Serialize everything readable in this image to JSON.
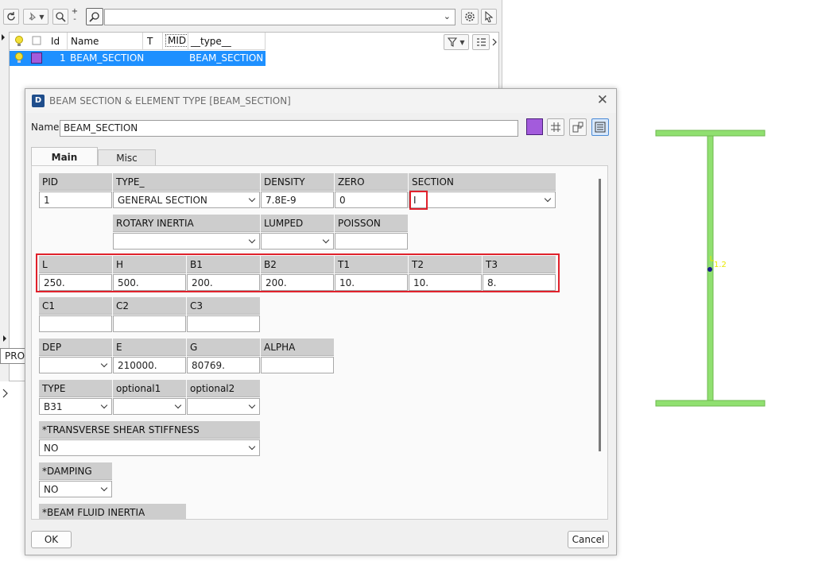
{
  "toolbar": {
    "zoom_plus": "+",
    "zoom_minus": "-",
    "filter_value": ""
  },
  "grid": {
    "columns": [
      "Id",
      "Name",
      "T",
      "MID",
      "__type__"
    ],
    "rows": [
      {
        "id": "1",
        "name": "BEAM_SECTION",
        "t": "",
        "mid": "",
        "type": "BEAM_SECTION",
        "color": "#a35bdc"
      }
    ]
  },
  "side_tab": {
    "label": "PRO"
  },
  "viewport": {
    "node_label": "1.2",
    "beam_color": "#90e070",
    "node_color": "#1a1a8c",
    "label_color": "#e8e800"
  },
  "dialog": {
    "title": "BEAM SECTION & ELEMENT TYPE [BEAM_SECTION]",
    "name_label": "Name",
    "name_value": "BEAM_SECTION",
    "color": "#a35bdc",
    "tabs": [
      "Main",
      "Misc"
    ],
    "ok_label": "OK",
    "cancel_label": "Cancel",
    "highlight_color": "#e0212b",
    "fields": {
      "pid": {
        "label": "PID",
        "value": "1"
      },
      "type_": {
        "label": "TYPE_",
        "value": "GENERAL SECTION"
      },
      "density": {
        "label": "DENSITY",
        "value": "7.8E-9"
      },
      "zero": {
        "label": "ZERO",
        "value": "0"
      },
      "section": {
        "label": "SECTION",
        "value": "I"
      },
      "rotary": {
        "label": "ROTARY INERTIA",
        "value": ""
      },
      "lumped": {
        "label": "LUMPED",
        "value": ""
      },
      "poisson": {
        "label": "POISSON",
        "value": ""
      },
      "l": {
        "label": "L",
        "value": "250."
      },
      "h": {
        "label": "H",
        "value": "500."
      },
      "b1": {
        "label": "B1",
        "value": "200."
      },
      "b2": {
        "label": "B2",
        "value": "200."
      },
      "t1": {
        "label": "T1",
        "value": "10."
      },
      "t2": {
        "label": "T2",
        "value": "10."
      },
      "t3": {
        "label": "T3",
        "value": "8."
      },
      "c1": {
        "label": "C1",
        "value": ""
      },
      "c2": {
        "label": "C2",
        "value": ""
      },
      "c3": {
        "label": "C3",
        "value": ""
      },
      "dep": {
        "label": "DEP",
        "value": ""
      },
      "e": {
        "label": "E",
        "value": "210000."
      },
      "g": {
        "label": "G",
        "value": "80769."
      },
      "alpha": {
        "label": "ALPHA",
        "value": ""
      },
      "elemtype": {
        "label": "TYPE",
        "value": "B31"
      },
      "optional1": {
        "label": "optional1",
        "value": ""
      },
      "optional2": {
        "label": "optional2",
        "value": ""
      },
      "shear": {
        "label": "*TRANSVERSE SHEAR STIFFNESS",
        "value": "NO"
      },
      "damping": {
        "label": "*DAMPING",
        "value": "NO"
      },
      "fluid": {
        "label": "*BEAM FLUID INERTIA",
        "value": ""
      }
    }
  }
}
